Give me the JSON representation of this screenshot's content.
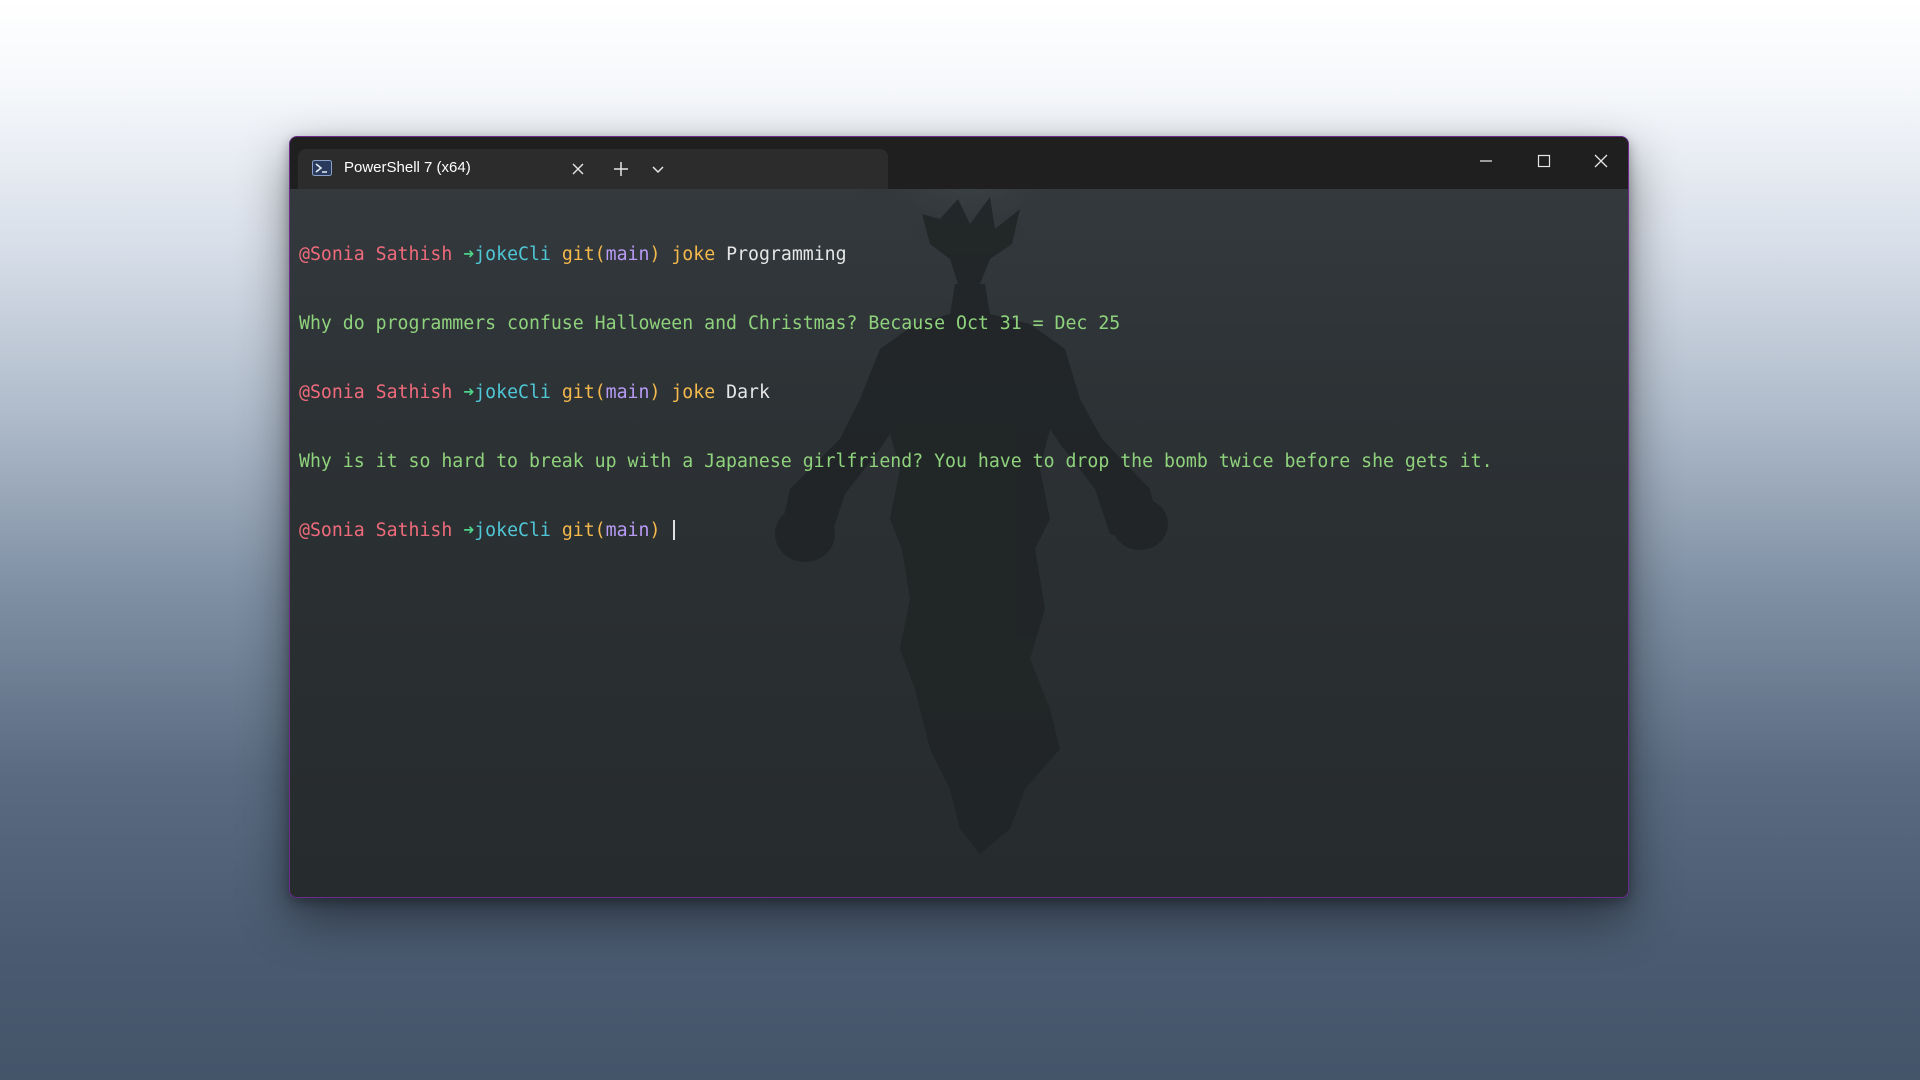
{
  "window": {
    "tab_title": "PowerShell 7 (x64)",
    "tab_icon": "powershell-icon",
    "buttons": {
      "new_tab": "plus-icon",
      "dropdown": "chevron-down-icon",
      "minimize": "minimize-icon",
      "maximize": "maximize-icon",
      "close": "close-icon"
    },
    "colors": {
      "border": "#6b2a8c",
      "titlebar": "#1f1f1f",
      "tab": "#2c2c2c",
      "terminal_bg": "#2c3134"
    }
  },
  "terminal": {
    "prompt": {
      "user": "@Sonia Sathish",
      "arrow": "➜",
      "dir": "jokeCli",
      "git": "git(",
      "branch": "main",
      "git_close": ")"
    },
    "lines": [
      {
        "type": "prompt",
        "cmd": "joke",
        "arg": "Programming"
      },
      {
        "type": "output",
        "text": "Why do programmers confuse Halloween and Christmas? Because Oct 31 = Dec 25"
      },
      {
        "type": "prompt",
        "cmd": "joke",
        "arg": "Dark"
      },
      {
        "type": "output",
        "text": "Why is it so hard to break up with a Japanese girlfriend? You have to drop the bomb twice before she gets it."
      },
      {
        "type": "prompt",
        "cmd": "",
        "arg": ""
      }
    ],
    "colors": {
      "user": "#ef6b7b",
      "arrow": "#4ed38a",
      "dir": "#4fc7d6",
      "git": "#f5b94c",
      "branch": "#b89bf5",
      "output": "#8fd27c"
    }
  }
}
